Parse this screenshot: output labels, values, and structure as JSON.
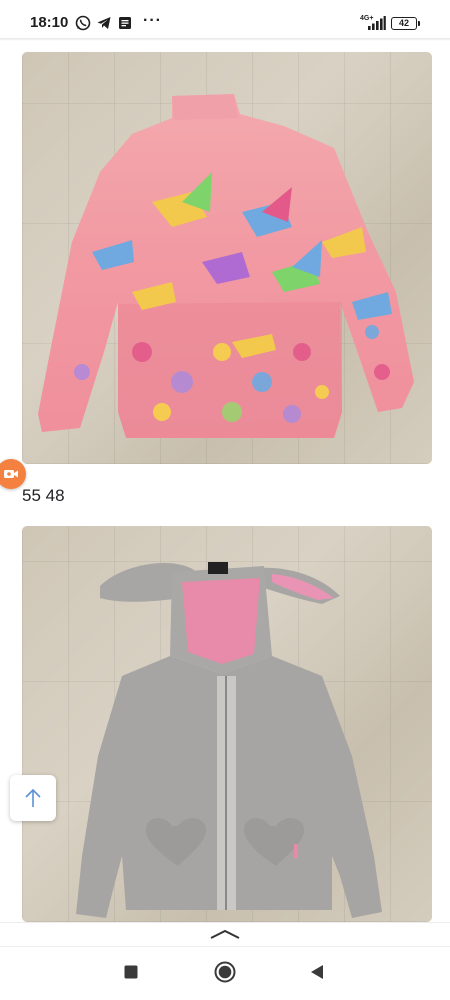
{
  "status_bar": {
    "time": "18:10",
    "icons": [
      "whatsapp-icon",
      "telegram-icon",
      "message-icon"
    ],
    "more": "···",
    "network": "4G+",
    "battery": "42"
  },
  "listing": {
    "photos": [
      {
        "subject": "pink-hummingbird-turtleneck"
      },
      {
        "subject": "grey-bunny-ear-hoodie"
      }
    ],
    "caption": "55 48"
  },
  "colors": {
    "accent_orange": "#f4813f",
    "scroll_arrow": "#5b8fd6"
  },
  "controls": {
    "scroll_top_icon": "arrow-up-icon",
    "floating_icon": "video-camera-icon"
  },
  "nav": {
    "buttons": [
      "recent-apps-icon",
      "home-icon",
      "back-icon"
    ]
  }
}
